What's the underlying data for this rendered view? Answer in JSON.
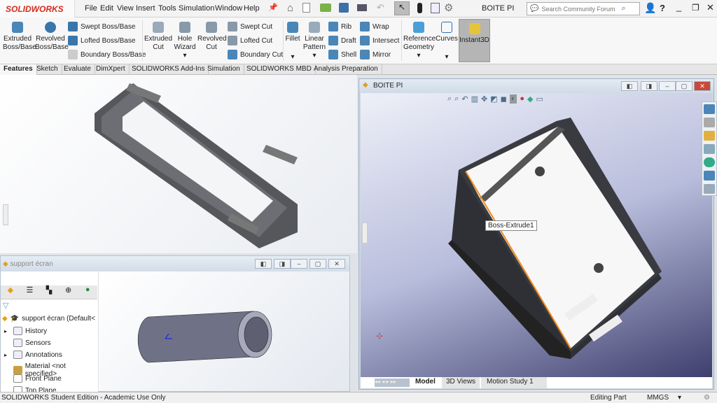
{
  "app": {
    "logo": "SOLIDWORKS",
    "doc_title": "BOITE PI"
  },
  "menu": [
    "File",
    "Edit",
    "View",
    "Insert",
    "Tools",
    "Simulation",
    "Window",
    "Help"
  ],
  "search": {
    "placeholder": "Search Community Forum"
  },
  "ribbon": {
    "big": [
      {
        "label": "Extruded Boss/Base"
      },
      {
        "label": "Revolved Boss/Base"
      },
      {
        "label": "Extruded Cut"
      },
      {
        "label": "Hole Wizard"
      },
      {
        "label": "Revolved Cut"
      },
      {
        "label": "Fillet"
      },
      {
        "label": "Linear Pattern"
      },
      {
        "label": "Reference Geometry"
      },
      {
        "label": "Curves"
      },
      {
        "label": "Instant3D"
      }
    ],
    "small": [
      {
        "label": "Swept Boss/Base"
      },
      {
        "label": "Lofted Boss/Base"
      },
      {
        "label": "Boundary Boss/Base"
      },
      {
        "label": "Swept Cut"
      },
      {
        "label": "Lofted Cut"
      },
      {
        "label": "Boundary Cut"
      },
      {
        "label": "Rib"
      },
      {
        "label": "Draft"
      },
      {
        "label": "Shell"
      },
      {
        "label": "Wrap"
      },
      {
        "label": "Intersect"
      },
      {
        "label": "Mirror"
      }
    ]
  },
  "tabs": [
    "Features",
    "Sketch",
    "Evaluate",
    "DimXpert",
    "SOLIDWORKS Add-Ins",
    "Simulation",
    "SOLIDWORKS MBD",
    "Analysis Preparation"
  ],
  "support_window": {
    "title": "support écran",
    "tree": [
      "support écran  (Default<",
      "History",
      "Sensors",
      "Annotations",
      "Material <not specified>",
      "Front Plane",
      "Top Plane"
    ]
  },
  "main_window": {
    "title": "BOITE PI",
    "tooltip": "Boss-Extrude1",
    "bottom_tabs": [
      "Model",
      "3D Views",
      "Motion Study 1"
    ]
  },
  "status": {
    "edition": "SOLIDWORKS Student Edition - Academic Use Only",
    "mode": "Editing Part",
    "units": "MMGS"
  },
  "colors": {
    "brand": "#d52b1e",
    "highlight": "#f08a1c"
  }
}
